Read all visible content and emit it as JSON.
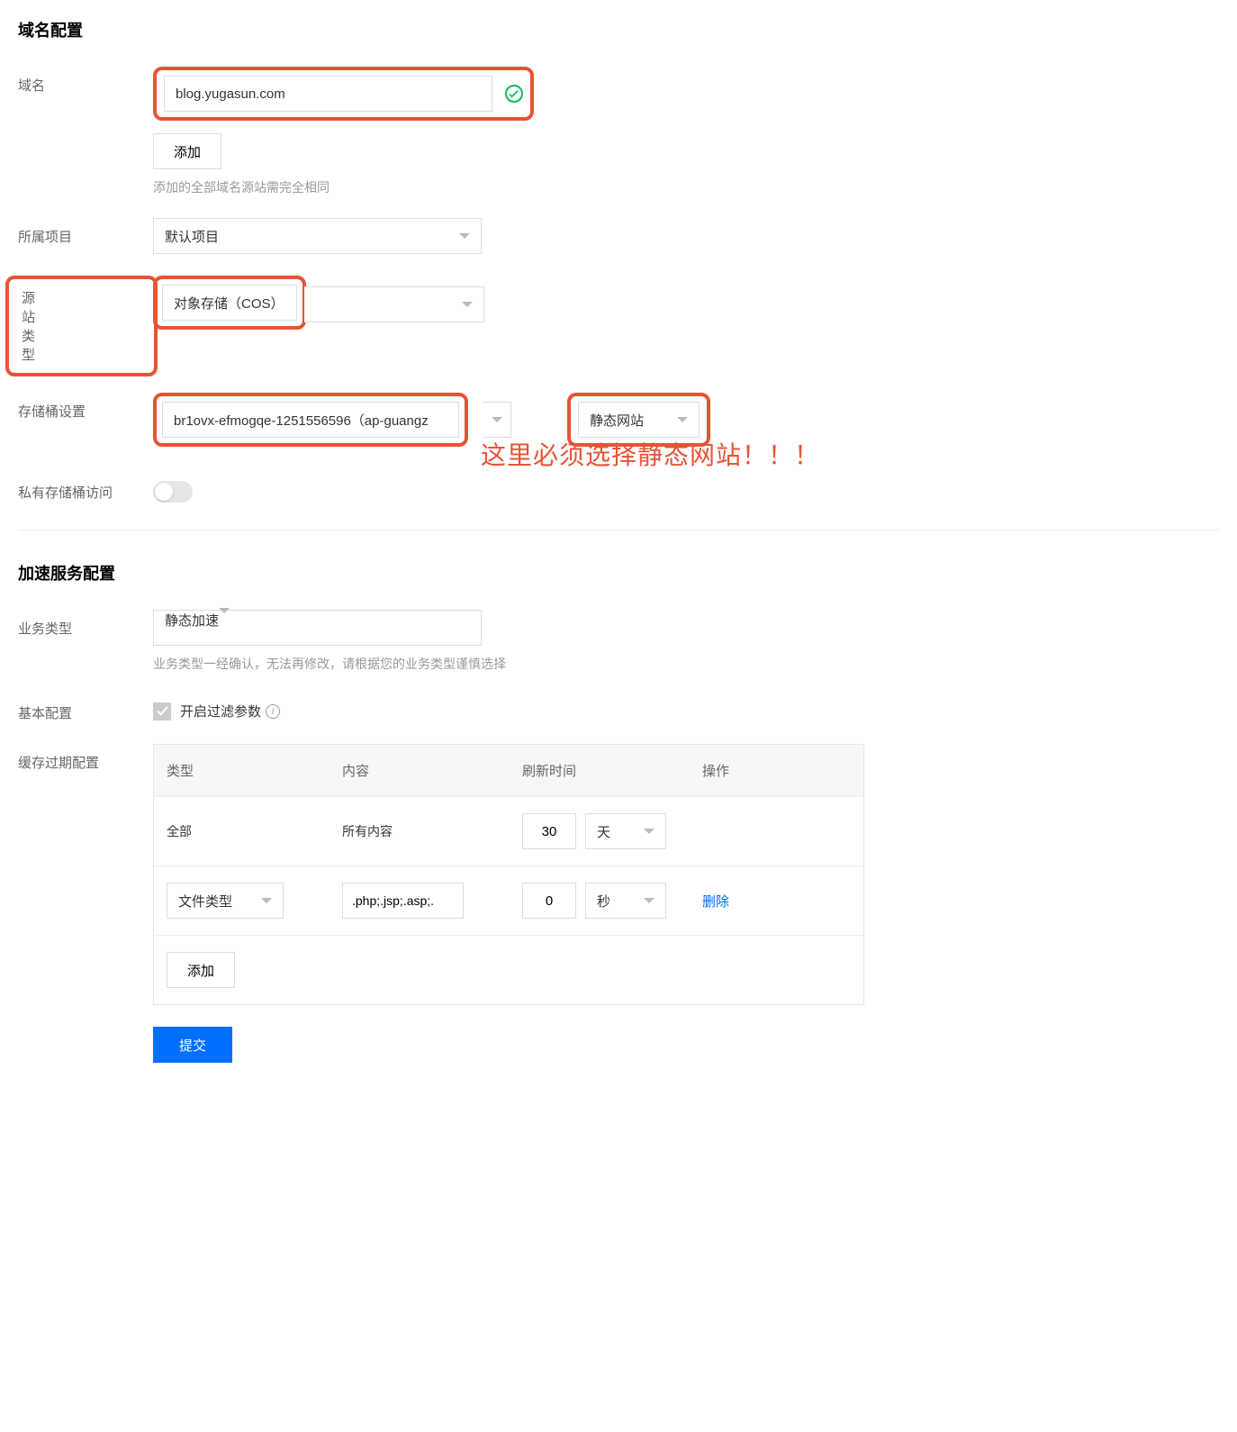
{
  "domain_config": {
    "heading": "域名配置",
    "domain_label": "域名",
    "domain_value": "blog.yugasun.com",
    "add_button": "添加",
    "domain_hint": "添加的全部域名源站需完全相同",
    "project_label": "所属项目",
    "project_value": "默认项目",
    "origin_type_label": "源站类型",
    "origin_type_value": "对象存储（COS）",
    "bucket_label": "存储桶设置",
    "bucket_value": "br1ovx-efmogqe-1251556596（ap-guangz",
    "static_site_value": "静态网站",
    "private_access_label": "私有存储桶访问",
    "annotation": "这里必须选择静态网站！！！"
  },
  "accel_config": {
    "heading": "加速服务配置",
    "biz_type_label": "业务类型",
    "biz_type_value": "静态加速",
    "biz_type_hint": "业务类型一经确认，无法再修改，请根据您的业务类型谨慎选择",
    "basic_label": "基本配置",
    "filter_param_label": "开启过滤参数",
    "cache_label": "缓存过期配置",
    "table": {
      "headers": {
        "type": "类型",
        "content": "内容",
        "refresh": "刷新时间",
        "action": "操作"
      },
      "rows": [
        {
          "type": "全部",
          "content": "所有内容",
          "refresh_value": "30",
          "refresh_unit": "天"
        },
        {
          "type_select": "文件类型",
          "content_input": ".php;.jsp;.asp;.",
          "refresh_value": "0",
          "refresh_unit": "秒",
          "action": "删除"
        }
      ],
      "add_button": "添加"
    }
  },
  "submit_label": "提交"
}
